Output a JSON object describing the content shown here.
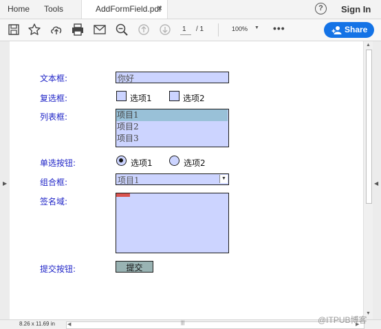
{
  "tabs": {
    "home": "Home",
    "tools": "Tools",
    "document": "AddFormField.pdf",
    "close": "×"
  },
  "header": {
    "help": "?",
    "sign_in": "Sign In"
  },
  "toolbar": {
    "icons": [
      "save-icon",
      "bookmark-star-icon",
      "upload-cloud-icon",
      "print-icon",
      "email-icon",
      "zoom-out-icon",
      "page-up-icon",
      "page-down-icon",
      "more-icon"
    ],
    "page_current": "1",
    "page_total": "/ 1",
    "zoom": "100%",
    "more": "•••",
    "share": "Share"
  },
  "form": {
    "text_box": {
      "label": "文本框:",
      "value": "你好"
    },
    "checkbox": {
      "label": "复选框:",
      "options": [
        "选项1",
        "选项2"
      ],
      "checked": [
        false,
        false
      ]
    },
    "list_box": {
      "label": "列表框:",
      "items": [
        "项目1",
        "项目2",
        "项目3"
      ],
      "selected": "项目1"
    },
    "radio": {
      "label": "单选按钮:",
      "options": [
        "选项1",
        "选项2"
      ],
      "selected": "选项1"
    },
    "combo_box": {
      "label": "组合框:",
      "value": "项目1"
    },
    "signature": {
      "label": "签名域:"
    },
    "submit": {
      "label": "提交按钮:",
      "button": "提交"
    }
  },
  "status": {
    "page_size": "8.26 x 11.69 in"
  },
  "watermark": "@ITPUB博客",
  "colors": {
    "accent": "#1473e6",
    "field_fill": "#ccd4ff",
    "label_text": "#1f24c7",
    "list_selected": "#99c1d8",
    "submit_fill": "#99b3b3"
  }
}
